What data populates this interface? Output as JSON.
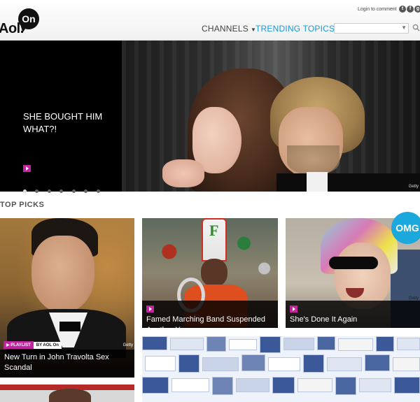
{
  "header": {
    "logo_aol": "Aol.",
    "logo_on": "On",
    "login_text": "Login to comment",
    "social": [
      "t",
      "f",
      "g"
    ],
    "nav": {
      "channels": "CHANNELS",
      "trending": "TRENDING TOPICS",
      "caret": "▼"
    },
    "search": {
      "placeholder": "",
      "dropdown": "▼"
    }
  },
  "hero": {
    "title": "SHE BOUGHT HIM WHAT?!",
    "credit": "Getty",
    "slide_count": 7,
    "active_slide": 1
  },
  "section": {
    "title": "TOP PICKS"
  },
  "cards": [
    {
      "caption": "New Turn in John Travolta Sex Scandal",
      "tag_playlist": "PLAYLIST",
      "tag_by": "BY AOL On",
      "credit": "Getty"
    },
    {
      "caption": "Famed Marching Band Suspended Another Year"
    },
    {
      "caption": "She's Done It Again",
      "badge": "OMG",
      "credit": "Getty"
    }
  ],
  "colors": {
    "accent_blue": "#1a9ad6",
    "play_magenta": "#c0259f",
    "omg_blue": "#1aa8dd"
  }
}
